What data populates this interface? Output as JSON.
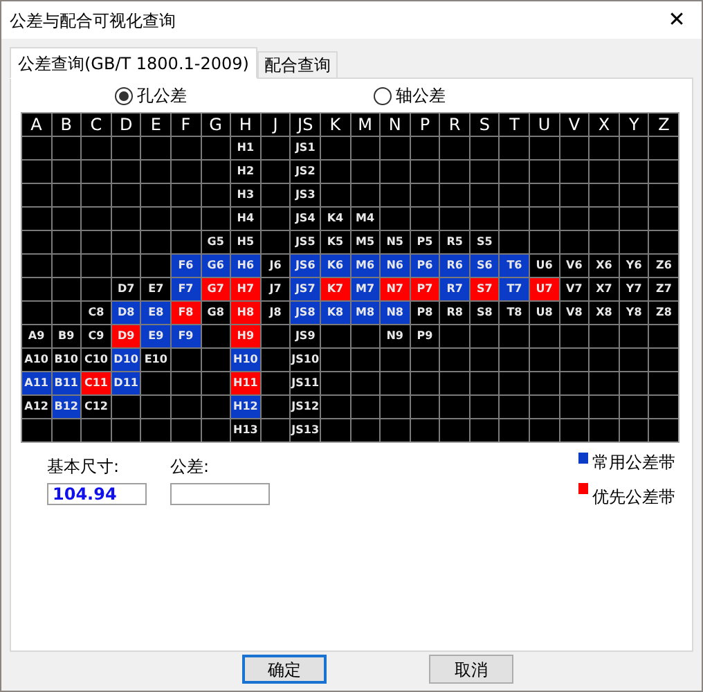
{
  "window": {
    "title": "公差与配合可视化查询",
    "close": "✕"
  },
  "tabs": [
    {
      "label": "公差查询(GB/T 1800.1-2009)",
      "selected": true
    },
    {
      "label": "配合查询",
      "selected": false
    }
  ],
  "radios": [
    {
      "label": "孔公差",
      "selected": true
    },
    {
      "label": "轴公差",
      "selected": false
    }
  ],
  "grid": {
    "columns": [
      "A",
      "B",
      "C",
      "D",
      "E",
      "F",
      "G",
      "H",
      "J",
      "JS",
      "K",
      "M",
      "N",
      "P",
      "R",
      "S",
      "T",
      "U",
      "V",
      "X",
      "Y",
      "Z"
    ],
    "rows": [
      {
        "cells": [
          null,
          null,
          null,
          null,
          null,
          null,
          null,
          {
            "text": "H1",
            "color": "#000000"
          },
          null,
          {
            "text": "JS1",
            "color": "#000000"
          },
          null,
          null,
          null,
          null,
          null,
          null,
          null,
          null,
          null,
          null,
          null,
          null
        ]
      },
      {
        "cells": [
          null,
          null,
          null,
          null,
          null,
          null,
          null,
          {
            "text": "H2",
            "color": "#000000"
          },
          null,
          {
            "text": "JS2",
            "color": "#000000"
          },
          null,
          null,
          null,
          null,
          null,
          null,
          null,
          null,
          null,
          null,
          null,
          null
        ]
      },
      {
        "cells": [
          null,
          null,
          null,
          null,
          null,
          null,
          null,
          {
            "text": "H3",
            "color": "#000000"
          },
          null,
          {
            "text": "JS3",
            "color": "#000000"
          },
          null,
          null,
          null,
          null,
          null,
          null,
          null,
          null,
          null,
          null,
          null,
          null
        ]
      },
      {
        "cells": [
          null,
          null,
          null,
          null,
          null,
          null,
          null,
          {
            "text": "H4",
            "color": "#000000"
          },
          null,
          {
            "text": "JS4",
            "color": "#000000"
          },
          {
            "text": "K4",
            "color": "#000000"
          },
          {
            "text": "M4",
            "color": "#000000"
          },
          null,
          null,
          null,
          null,
          null,
          null,
          null,
          null,
          null,
          null
        ]
      },
      {
        "cells": [
          null,
          null,
          null,
          null,
          null,
          null,
          {
            "text": "G5",
            "color": "#000000"
          },
          {
            "text": "H5",
            "color": "#000000"
          },
          null,
          {
            "text": "JS5",
            "color": "#000000"
          },
          {
            "text": "K5",
            "color": "#000000"
          },
          {
            "text": "M5",
            "color": "#000000"
          },
          {
            "text": "N5",
            "color": "#000000"
          },
          {
            "text": "P5",
            "color": "#000000"
          },
          {
            "text": "R5",
            "color": "#000000"
          },
          {
            "text": "S5",
            "color": "#000000"
          },
          null,
          null,
          null,
          null,
          null,
          null
        ]
      },
      {
        "cells": [
          null,
          null,
          null,
          null,
          null,
          {
            "text": "F6",
            "color": "#0a3cc8"
          },
          {
            "text": "G6",
            "color": "#0a3cc8"
          },
          {
            "text": "H6",
            "color": "#0a3cc8"
          },
          {
            "text": "J6",
            "color": "#000000"
          },
          {
            "text": "JS6",
            "color": "#0a3cc8"
          },
          {
            "text": "K6",
            "color": "#0a3cc8"
          },
          {
            "text": "M6",
            "color": "#0a3cc8"
          },
          {
            "text": "N6",
            "color": "#0a3cc8"
          },
          {
            "text": "P6",
            "color": "#0a3cc8"
          },
          {
            "text": "R6",
            "color": "#0a3cc8"
          },
          {
            "text": "S6",
            "color": "#0a3cc8"
          },
          {
            "text": "T6",
            "color": "#0a3cc8"
          },
          {
            "text": "U6",
            "color": "#000000"
          },
          {
            "text": "V6",
            "color": "#000000"
          },
          {
            "text": "X6",
            "color": "#000000"
          },
          {
            "text": "Y6",
            "color": "#000000"
          },
          {
            "text": "Z6",
            "color": "#000000"
          }
        ]
      },
      {
        "cells": [
          null,
          null,
          null,
          {
            "text": "D7",
            "color": "#000000"
          },
          {
            "text": "E7",
            "color": "#000000"
          },
          {
            "text": "F7",
            "color": "#0a3cc8"
          },
          {
            "text": "G7",
            "color": "#ff0000"
          },
          {
            "text": "H7",
            "color": "#ff0000"
          },
          {
            "text": "J7",
            "color": "#000000"
          },
          {
            "text": "JS7",
            "color": "#0a3cc8"
          },
          {
            "text": "K7",
            "color": "#ff0000"
          },
          {
            "text": "M7",
            "color": "#0a3cc8"
          },
          {
            "text": "N7",
            "color": "#ff0000"
          },
          {
            "text": "P7",
            "color": "#ff0000"
          },
          {
            "text": "R7",
            "color": "#0a3cc8"
          },
          {
            "text": "S7",
            "color": "#ff0000"
          },
          {
            "text": "T7",
            "color": "#0a3cc8"
          },
          {
            "text": "U7",
            "color": "#ff0000"
          },
          {
            "text": "V7",
            "color": "#000000"
          },
          {
            "text": "X7",
            "color": "#000000"
          },
          {
            "text": "Y7",
            "color": "#000000"
          },
          {
            "text": "Z7",
            "color": "#000000"
          }
        ]
      },
      {
        "cells": [
          null,
          null,
          {
            "text": "C8",
            "color": "#000000"
          },
          {
            "text": "D8",
            "color": "#0a3cc8"
          },
          {
            "text": "E8",
            "color": "#0a3cc8"
          },
          {
            "text": "F8",
            "color": "#ff0000"
          },
          {
            "text": "G8",
            "color": "#000000"
          },
          {
            "text": "H8",
            "color": "#ff0000"
          },
          {
            "text": "J8",
            "color": "#000000"
          },
          {
            "text": "JS8",
            "color": "#0a3cc8"
          },
          {
            "text": "K8",
            "color": "#0a3cc8"
          },
          {
            "text": "M8",
            "color": "#0a3cc8"
          },
          {
            "text": "N8",
            "color": "#0a3cc8"
          },
          {
            "text": "P8",
            "color": "#000000"
          },
          {
            "text": "R8",
            "color": "#000000"
          },
          {
            "text": "S8",
            "color": "#000000"
          },
          {
            "text": "T8",
            "color": "#000000"
          },
          {
            "text": "U8",
            "color": "#000000"
          },
          {
            "text": "V8",
            "color": "#000000"
          },
          {
            "text": "X8",
            "color": "#000000"
          },
          {
            "text": "Y8",
            "color": "#000000"
          },
          {
            "text": "Z8",
            "color": "#000000"
          }
        ]
      },
      {
        "cells": [
          {
            "text": "A9",
            "color": "#000000"
          },
          {
            "text": "B9",
            "color": "#000000"
          },
          {
            "text": "C9",
            "color": "#000000"
          },
          {
            "text": "D9",
            "color": "#ff0000"
          },
          {
            "text": "E9",
            "color": "#0a3cc8"
          },
          {
            "text": "F9",
            "color": "#0a3cc8"
          },
          null,
          {
            "text": "H9",
            "color": "#ff0000"
          },
          null,
          {
            "text": "JS9",
            "color": "#000000"
          },
          null,
          null,
          {
            "text": "N9",
            "color": "#000000"
          },
          {
            "text": "P9",
            "color": "#000000"
          },
          null,
          null,
          null,
          null,
          null,
          null,
          null,
          null
        ]
      },
      {
        "cells": [
          {
            "text": "A10",
            "color": "#000000"
          },
          {
            "text": "B10",
            "color": "#000000"
          },
          {
            "text": "C10",
            "color": "#000000"
          },
          {
            "text": "D10",
            "color": "#0a3cc8"
          },
          {
            "text": "E10",
            "color": "#000000"
          },
          null,
          null,
          {
            "text": "H10",
            "color": "#0a3cc8"
          },
          null,
          {
            "text": "JS10",
            "color": "#000000"
          },
          null,
          null,
          null,
          null,
          null,
          null,
          null,
          null,
          null,
          null,
          null,
          null
        ]
      },
      {
        "cells": [
          {
            "text": "A11",
            "color": "#0a3cc8"
          },
          {
            "text": "B11",
            "color": "#0a3cc8"
          },
          {
            "text": "C11",
            "color": "#ff0000"
          },
          {
            "text": "D11",
            "color": "#0a3cc8"
          },
          null,
          null,
          null,
          {
            "text": "H11",
            "color": "#ff0000"
          },
          null,
          {
            "text": "JS11",
            "color": "#000000"
          },
          null,
          null,
          null,
          null,
          null,
          null,
          null,
          null,
          null,
          null,
          null,
          null
        ]
      },
      {
        "cells": [
          {
            "text": "A12",
            "color": "#000000"
          },
          {
            "text": "B12",
            "color": "#0a3cc8"
          },
          {
            "text": "C12",
            "color": "#000000"
          },
          null,
          null,
          null,
          null,
          {
            "text": "H12",
            "color": "#0a3cc8"
          },
          null,
          {
            "text": "JS12",
            "color": "#000000"
          },
          null,
          null,
          null,
          null,
          null,
          null,
          null,
          null,
          null,
          null,
          null,
          null
        ]
      },
      {
        "cells": [
          null,
          null,
          null,
          null,
          null,
          null,
          null,
          {
            "text": "H13",
            "color": "#000000"
          },
          null,
          {
            "text": "JS13",
            "color": "#000000"
          },
          null,
          null,
          null,
          null,
          null,
          null,
          null,
          null,
          null,
          null,
          null,
          null
        ]
      }
    ]
  },
  "fields": [
    {
      "label": "基本尺寸:",
      "value": "104.94"
    },
    {
      "label": "公差:"
    }
  ],
  "legend": [
    {
      "label": "常用公差带",
      "color": "#0a3cc8"
    },
    {
      "label": "优先公差带",
      "color": "#ff0000"
    }
  ],
  "buttons": [
    {
      "label": "确定",
      "focused": true
    },
    {
      "label": "取消",
      "focused": false
    }
  ]
}
